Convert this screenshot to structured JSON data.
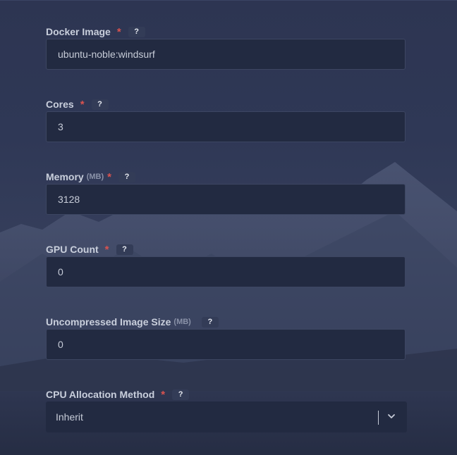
{
  "form": {
    "fields": [
      {
        "label": "Docker Image",
        "unit": "",
        "required": "*",
        "help": "?",
        "value": "ubuntu-noble:windsurf"
      },
      {
        "label": "Cores",
        "unit": "",
        "required": "*",
        "help": "?",
        "value": "3"
      },
      {
        "label": "Memory",
        "unit": "(MB)",
        "required": "*",
        "help": "?",
        "value": "3128"
      },
      {
        "label": "GPU Count",
        "unit": "",
        "required": "*",
        "help": "?",
        "value": "0"
      },
      {
        "label": "Uncompressed Image Size",
        "unit": "(MB)",
        "required": "",
        "help": "?",
        "value": "0"
      },
      {
        "label": "CPU Allocation Method",
        "unit": "",
        "required": "*",
        "help": "?",
        "value": "Inherit",
        "icon": "chevron-down-icon"
      }
    ]
  },
  "colors": {
    "required": "#d9534f",
    "input_bg": "#222a41",
    "label": "#c9cfdc"
  }
}
